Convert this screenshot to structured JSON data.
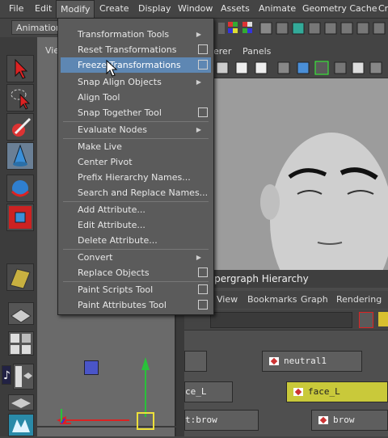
{
  "menubar": {
    "items": [
      {
        "label": "File"
      },
      {
        "label": "Edit"
      },
      {
        "label": "Modify"
      },
      {
        "label": "Create"
      },
      {
        "label": "Display"
      },
      {
        "label": "Window"
      },
      {
        "label": "Assets"
      },
      {
        "label": "Animate"
      },
      {
        "label": "Geometry Cache"
      },
      {
        "label": "Cr"
      }
    ],
    "active": "Modify"
  },
  "statusline": {
    "mode": "Animation"
  },
  "modify_menu": {
    "items": [
      {
        "label": "Transformation Tools",
        "submenu": true
      },
      {
        "label": "Reset Transformations",
        "option_box": true
      },
      {
        "label": "Freeze Transformations",
        "option_box": true,
        "highlighted": true
      },
      {
        "label": "Snap Align Objects",
        "submenu": true
      },
      {
        "label": "Align Tool"
      },
      {
        "label": "Snap Together Tool",
        "option_box": true
      },
      {
        "label": "Evaluate Nodes",
        "submenu": true
      },
      {
        "label": "Make Live"
      },
      {
        "label": "Center Pivot"
      },
      {
        "label": "Prefix Hierarchy Names..."
      },
      {
        "label": "Search and Replace Names..."
      },
      {
        "label": "Add Attribute..."
      },
      {
        "label": "Edit Attribute..."
      },
      {
        "label": "Delete Attribute..."
      },
      {
        "label": "Convert",
        "submenu": true
      },
      {
        "label": "Replace Objects",
        "option_box": true
      },
      {
        "label": "Paint Scripts Tool",
        "option_box": true
      },
      {
        "label": "Paint Attributes Tool",
        "option_box": true
      }
    ]
  },
  "viewport_left": {
    "menu_fragment": "Vie"
  },
  "viewport_right": {
    "menu_fragment_1": "erer",
    "menu_fragment_2": "Panels"
  },
  "hypergraph": {
    "title": "ypergraph Hierarchy",
    "menu": [
      "View",
      "Bookmarks",
      "Graph",
      "Rendering"
    ],
    "nodes": [
      {
        "label": "neutral1"
      },
      {
        "label": "ce_L"
      },
      {
        "label": "face_L",
        "selected": true
      },
      {
        "label": "t:brow"
      },
      {
        "label": "brow"
      }
    ]
  },
  "toolbox": {
    "tools": [
      {
        "name": "select-tool-icon"
      },
      {
        "name": "lasso-tool-icon"
      },
      {
        "name": "paint-select-tool-icon"
      },
      {
        "name": "move-tool-icon"
      },
      {
        "name": "rotate-tool-icon"
      },
      {
        "name": "scale-tool-icon"
      },
      {
        "name": "last-tool-icon"
      }
    ]
  }
}
